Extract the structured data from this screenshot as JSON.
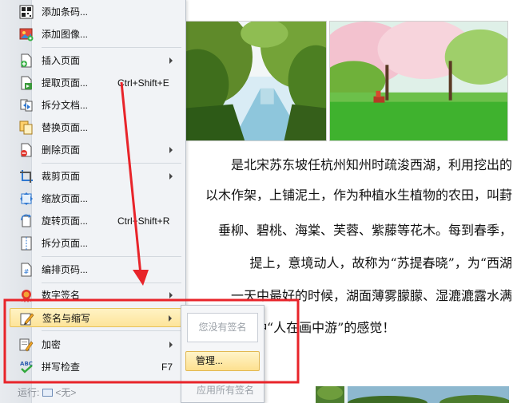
{
  "document": {
    "lines": [
      "是北宋苏东坡任杭州知州时疏浚西湖，利用挖出的",
      "以木作架，上铺泥土，作为种植水生植物的农田，叫葑",
      "垂柳、碧桃、海棠、芙蓉、紫藤等花木。每到春季，",
      "提上，意境动人，故称为“苏提春晓”，为“西湖",
      "一天中最好的时候，湖面薄雾朦朦、湿漉漉露水满",
      "种“人在画中游”的感觉！"
    ]
  },
  "menu": {
    "items": [
      {
        "label": "添加条码...",
        "icon": "barcode-icon"
      },
      {
        "label": "添加图像...",
        "icon": "add-image-icon"
      },
      {
        "label": "插入页面",
        "icon": "insert-page-icon",
        "submenu": true
      },
      {
        "label": "提取页面...",
        "shortcut": "Ctrl+Shift+E",
        "icon": "extract-page-icon"
      },
      {
        "label": "拆分文档...",
        "icon": "split-document-icon"
      },
      {
        "label": "替换页面...",
        "icon": "replace-page-icon"
      },
      {
        "label": "删除页面",
        "icon": "delete-page-icon",
        "submenu": true
      },
      {
        "label": "裁剪页面",
        "icon": "crop-page-icon",
        "submenu": true
      },
      {
        "label": "缩放页面...",
        "icon": "scale-page-icon"
      },
      {
        "label": "旋转页面...",
        "shortcut": "Ctrl+Shift+R",
        "icon": "rotate-page-icon"
      },
      {
        "label": "拆分页面...",
        "icon": "split-page-icon"
      },
      {
        "label": "编排页码...",
        "icon": "page-numbering-icon"
      },
      {
        "label": "数字签名",
        "icon": "digital-signature-icon",
        "submenu": true
      },
      {
        "label": "签名与缩写",
        "icon": "signature-pen-icon",
        "submenu": true,
        "highlighted": true
      },
      {
        "label": "加密",
        "icon": "encrypt-icon",
        "submenu": true
      },
      {
        "label": "拼写检查",
        "shortcut": "F7",
        "icon": "spell-check-icon"
      }
    ],
    "footer": {
      "label": "运行:",
      "value": "<无>"
    }
  },
  "submenu": {
    "no_signature": "您没有签名",
    "manage": "管理...",
    "apply_all": "应用所有签名"
  },
  "colors": {
    "annotation_red": "#e8242a",
    "highlight": "#fde49a"
  }
}
